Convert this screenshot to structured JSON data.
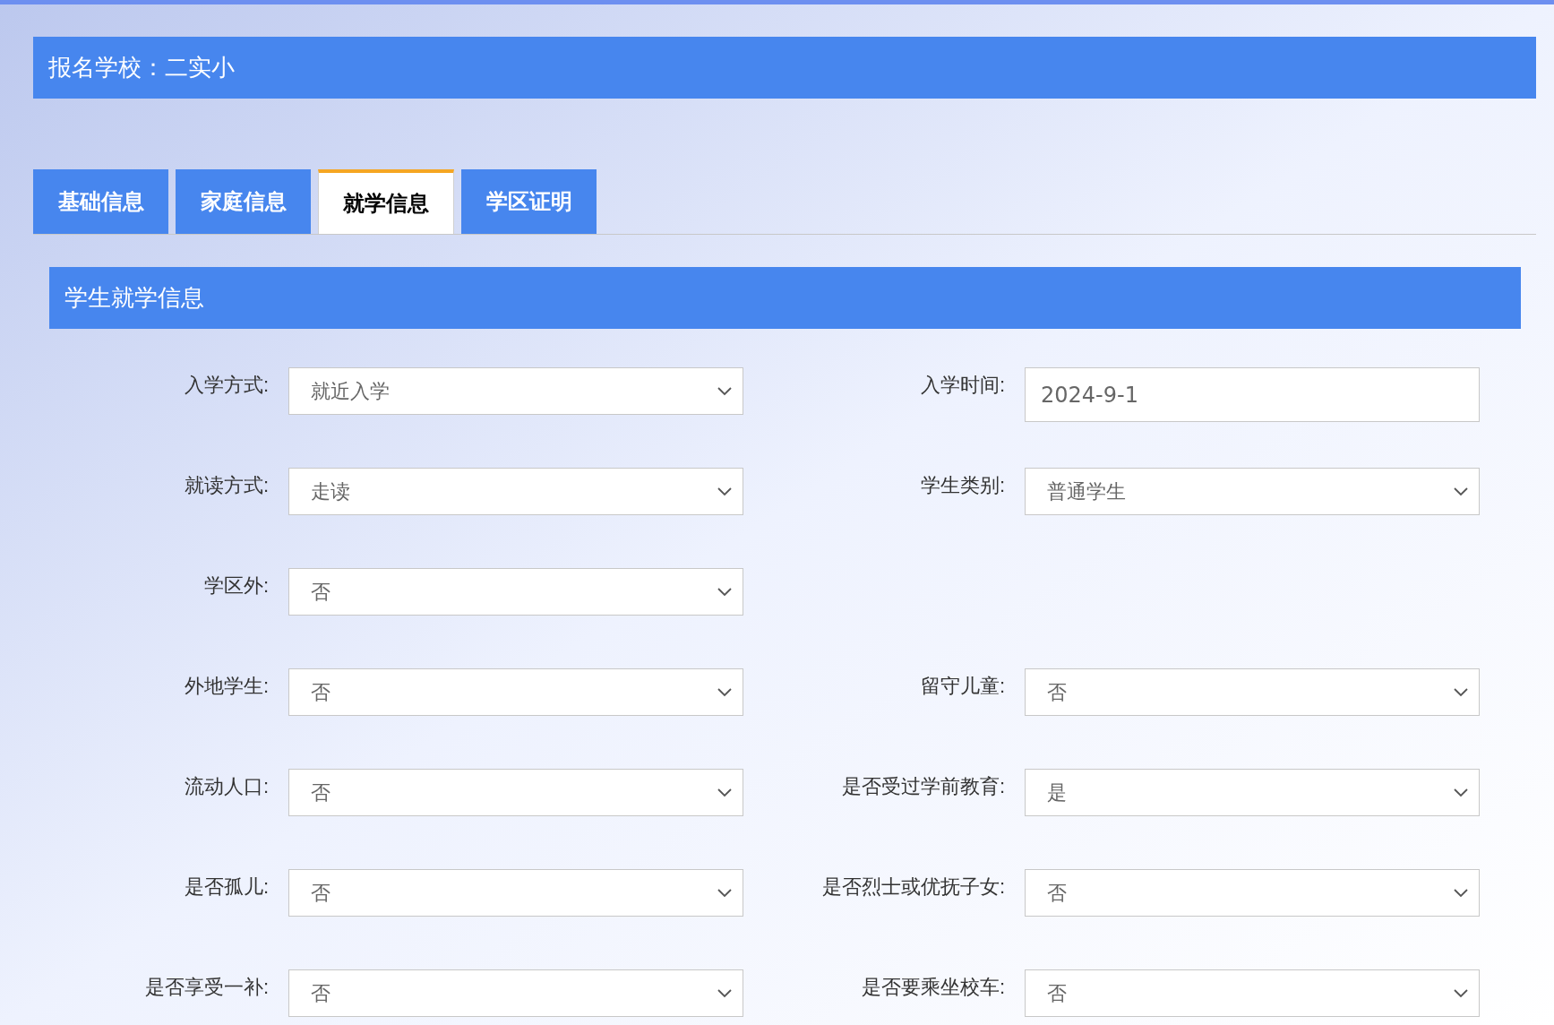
{
  "header": {
    "title": "报名学校：二实小"
  },
  "tabs": [
    {
      "label": "基础信息",
      "selected": false
    },
    {
      "label": "家庭信息",
      "selected": false
    },
    {
      "label": "就学信息",
      "selected": true
    },
    {
      "label": "学区证明",
      "selected": false
    }
  ],
  "section": {
    "title": "学生就学信息"
  },
  "rows": [
    {
      "left": {
        "label": "入学方式:",
        "kind": "select",
        "value": "就近入学"
      },
      "right": {
        "label": "入学时间:",
        "kind": "text",
        "value": "2024-9-1"
      }
    },
    {
      "left": {
        "label": "就读方式:",
        "kind": "select",
        "value": "走读"
      },
      "right": {
        "label": "学生类别:",
        "kind": "select",
        "value": "普通学生"
      }
    },
    {
      "left": {
        "label": "学区外:",
        "kind": "select",
        "value": "否"
      }
    },
    {
      "left": {
        "label": "外地学生:",
        "kind": "select",
        "value": "否"
      },
      "right": {
        "label": "留守儿童:",
        "kind": "select",
        "value": "否"
      }
    },
    {
      "left": {
        "label": "流动人口:",
        "kind": "select",
        "value": "否"
      },
      "right": {
        "label": "是否受过学前教育:",
        "kind": "select",
        "value": "是"
      }
    },
    {
      "left": {
        "label": "是否孤儿:",
        "kind": "select",
        "value": "否"
      },
      "right": {
        "label": "是否烈士或优抚子女:",
        "kind": "select",
        "value": "否"
      }
    },
    {
      "left": {
        "label": "是否享受一补:",
        "kind": "select",
        "value": "否"
      },
      "right": {
        "label": "是否要乘坐校车:",
        "kind": "select",
        "value": "否"
      }
    }
  ]
}
